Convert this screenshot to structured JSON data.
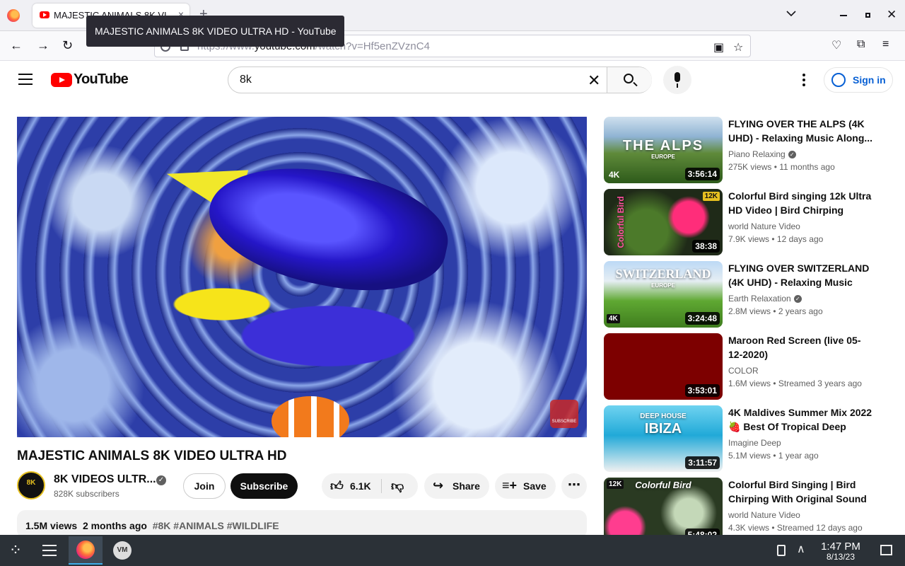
{
  "browser": {
    "tab_title": "MAJESTIC ANIMALS 8K VIDEO ULTRA HD - YouTube",
    "tooltip": "MAJESTIC ANIMALS 8K VIDEO ULTRA HD - YouTube",
    "url_prefix": "https://www.",
    "url_domain": "youtube.com",
    "url_path": "/watch?v=Hf5enZVznC4",
    "new_tab": "+",
    "close_tab": "×"
  },
  "youtube": {
    "logo_text": "YouTube",
    "search_value": "8k",
    "sign_in": "Sign in"
  },
  "video": {
    "title": "MAJESTIC ANIMALS 8K VIDEO ULTRA HD",
    "channel_name": "8K VIDEOS ULTR...",
    "channel_avatar_text": "8K",
    "subscribers": "828K subscribers",
    "join": "Join",
    "subscribe": "Subscribe",
    "likes": "6.1K",
    "share": "Share",
    "save": "Save",
    "watermark": "SUBSCRIBE",
    "views": "1.5M views",
    "age": "2 months ago",
    "tags": "#8K #ANIMALS #WILDLIFE"
  },
  "recommendations": [
    {
      "title": "FLYING OVER THE ALPS (4K UHD) - Relaxing Music Along...",
      "channel": "Piano Relaxing",
      "verified": true,
      "views": "275K views",
      "age": "11 months ago",
      "duration": "3:56:14",
      "thumb_text": "THE ALPS",
      "thumb_sub": "EUROPE",
      "badge": "4K"
    },
    {
      "title": "Colorful Bird singing 12k Ultra HD Video | Bird Chirping With...",
      "channel": "world Nature Video",
      "verified": false,
      "views": "7.9K views",
      "age": "12 days ago",
      "duration": "38:38",
      "thumb_text": "Colorful Bird",
      "thumb_sub": "",
      "badge": "12K"
    },
    {
      "title": "FLYING OVER SWITZERLAND (4K UHD) - Relaxing Music Wit...",
      "channel": "Earth Relaxation",
      "verified": true,
      "views": "2.8M views",
      "age": "2 years ago",
      "duration": "3:24:48",
      "thumb_text": "SWITZERLAND",
      "thumb_sub": "EUROPE",
      "badge": "4K"
    },
    {
      "title": "Maroon Red Screen (live 05-12-2020)",
      "channel": "COLOR",
      "verified": false,
      "views": "1.6M views",
      "age": "Streamed 3 years ago",
      "duration": "3:53:01",
      "thumb_text": "",
      "thumb_sub": "",
      "badge": ""
    },
    {
      "title": "4K Maldives Summer Mix 2022 🍓 Best Of Tropical Deep Hous...",
      "channel": "Imagine Deep",
      "verified": false,
      "views": "5.1M views",
      "age": "1 year ago",
      "duration": "3:11:57",
      "thumb_text": "IBIZA",
      "thumb_sub": "DEEP HOUSE",
      "badge": ""
    },
    {
      "title": "Colorful Bird Singing | Bird Chirping With Original Sound |...",
      "channel": "world Nature Video",
      "verified": false,
      "views": "4.3K views",
      "age": "Streamed 12 days ago",
      "duration": "5:48:02",
      "thumb_text": "Colorful Bird",
      "thumb_sub": "",
      "badge": "12K"
    }
  ],
  "taskbar": {
    "time": "1:47 PM",
    "date": "8/13/23",
    "vm_label": "VM"
  }
}
